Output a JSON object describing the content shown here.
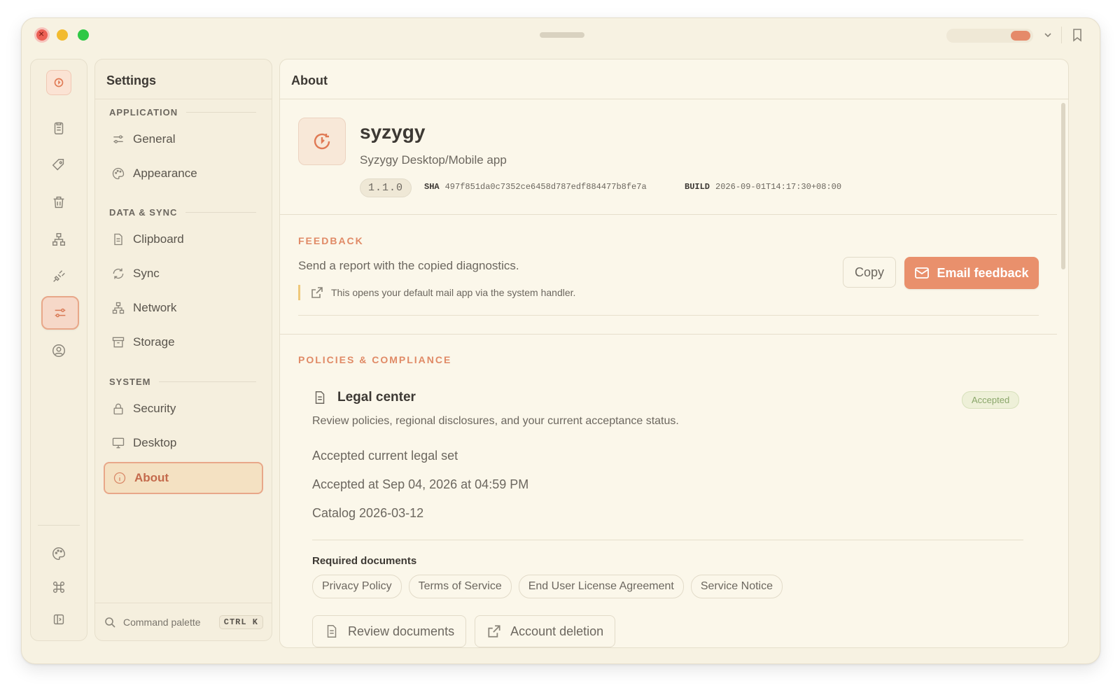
{
  "rail": {
    "items": [
      "logo",
      "clipboard-icon",
      "tag-icon",
      "trash-icon",
      "network-icon",
      "plug-icon",
      "sliders-icon",
      "user-icon"
    ],
    "bottom": [
      "palette-icon",
      "command-icon",
      "sidebar-toggle-icon"
    ]
  },
  "settings": {
    "title": "Settings",
    "groups": [
      {
        "label": "APPLICATION",
        "items": [
          {
            "label": "General",
            "icon": "sliders-icon"
          },
          {
            "label": "Appearance",
            "icon": "palette-icon"
          }
        ]
      },
      {
        "label": "DATA & SYNC",
        "items": [
          {
            "label": "Clipboard",
            "icon": "document-icon"
          },
          {
            "label": "Sync",
            "icon": "refresh-icon"
          },
          {
            "label": "Network",
            "icon": "network-icon"
          },
          {
            "label": "Storage",
            "icon": "archive-icon"
          }
        ]
      },
      {
        "label": "SYSTEM",
        "items": [
          {
            "label": "Security",
            "icon": "lock-icon"
          },
          {
            "label": "Desktop",
            "icon": "monitor-icon"
          },
          {
            "label": "About",
            "icon": "info-icon",
            "active": true
          }
        ]
      }
    ],
    "command_palette": {
      "label": "Command palette",
      "shortcut": "CTRL K"
    }
  },
  "main": {
    "title": "About",
    "app": {
      "name": "syzygy",
      "description": "Syzygy Desktop/Mobile app",
      "version": "1.1.0",
      "sha_label": "SHA",
      "sha": "497f851da0c7352ce6458d787edf884477b8fe7a",
      "build_label": "BUILD",
      "build": "2026-09-01T14:17:30+08:00"
    },
    "feedback": {
      "label": "FEEDBACK",
      "text": "Send a report with the copied diagnostics.",
      "note": "This opens your default mail app via the system handler.",
      "copy_label": "Copy",
      "email_label": "Email feedback"
    },
    "policies": {
      "label": "POLICIES & COMPLIANCE",
      "legal_title": "Legal center",
      "badge": "Accepted",
      "description": "Review policies, regional disclosures, and your current acceptance status.",
      "lines": [
        "Accepted current legal set",
        "Accepted at Sep 04, 2026 at 04:59 PM",
        "Catalog 2026-03-12"
      ],
      "required_label": "Required documents",
      "documents": [
        "Privacy Policy",
        "Terms of Service",
        "End User License Agreement",
        "Service Notice"
      ],
      "review_label": "Review documents",
      "deletion_label": "Account deletion"
    }
  },
  "colors": {
    "accent": "#e9906c",
    "background": "#f7f2e2",
    "accepted": "#8aa66a"
  }
}
